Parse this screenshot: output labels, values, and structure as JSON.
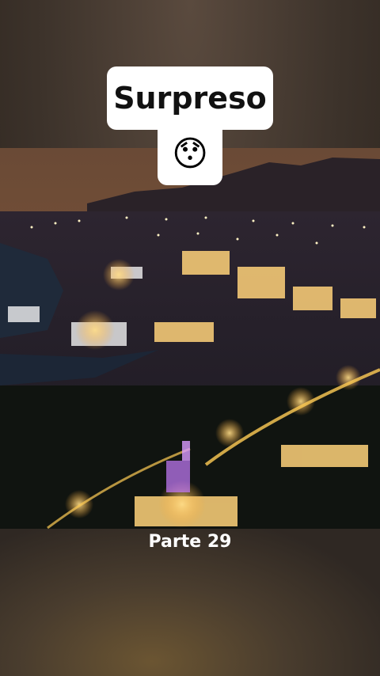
{
  "caption": {
    "title": "Surpreso",
    "emoji": "😯"
  },
  "photo": {
    "subject": "night-city-panorama"
  },
  "footer": {
    "part_label": "Parte 29"
  }
}
